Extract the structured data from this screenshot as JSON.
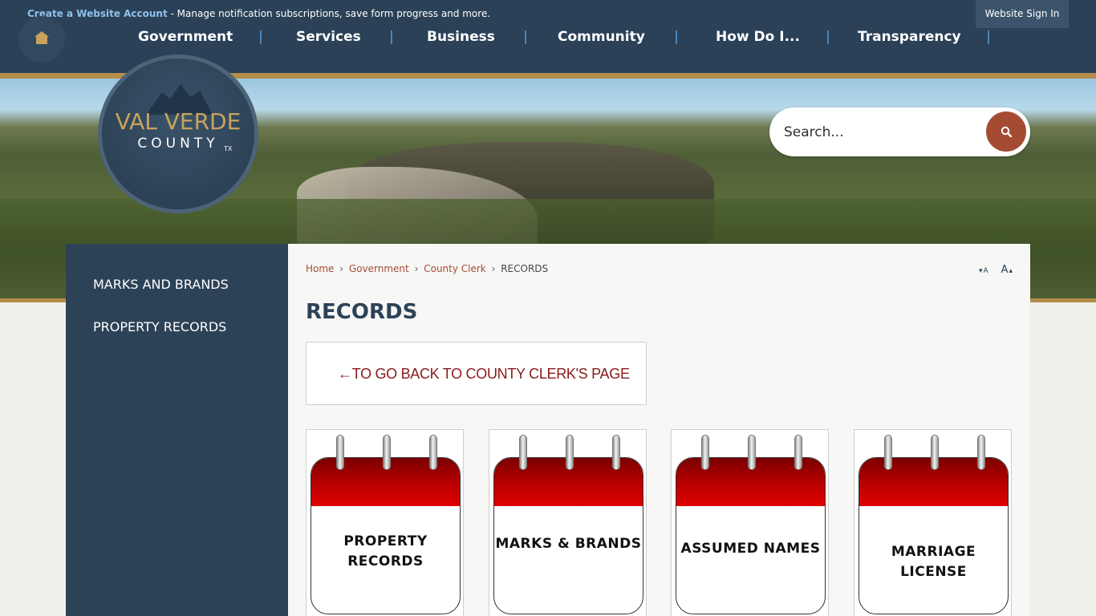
{
  "topbar": {
    "create_link": "Create a Website Account",
    "message": " - Manage notification subscriptions, save form progress and more.",
    "signin": "Website Sign In"
  },
  "nav": {
    "items": [
      "Government",
      "Services",
      "Business",
      "Community",
      "How Do I...",
      "Transparency"
    ]
  },
  "logo": {
    "line1": "VAL VERDE",
    "line2": "COUNTY",
    "state": "TX"
  },
  "search": {
    "placeholder": "Search..."
  },
  "sidebar": {
    "items": [
      "MARKS AND BRANDS",
      "PROPERTY RECORDS"
    ]
  },
  "breadcrumb": {
    "home": "Home",
    "government": "Government",
    "county_clerk": "County Clerk",
    "current": "RECORDS",
    "separator": "›"
  },
  "resize": {
    "smaller": "A",
    "larger": "A"
  },
  "page": {
    "title": "RECORDS",
    "back_link": "←TO GO BACK TO COUNTY CLERK'S PAGE"
  },
  "cards": [
    {
      "line1": "PROPERTY",
      "line2": "RECORDS"
    },
    {
      "line1": "MARKS & BRANDS",
      "line2": ""
    },
    {
      "line1": "ASSUMED NAMES",
      "line2": ""
    },
    {
      "line1": "MARRIAGE",
      "line2": "LICENSE"
    }
  ],
  "colors": {
    "navy": "#2c4257",
    "gold": "#b48d4a",
    "rust": "#a64b33",
    "link_blue": "#8fc0ea",
    "back_link": "#8b1a1a"
  }
}
